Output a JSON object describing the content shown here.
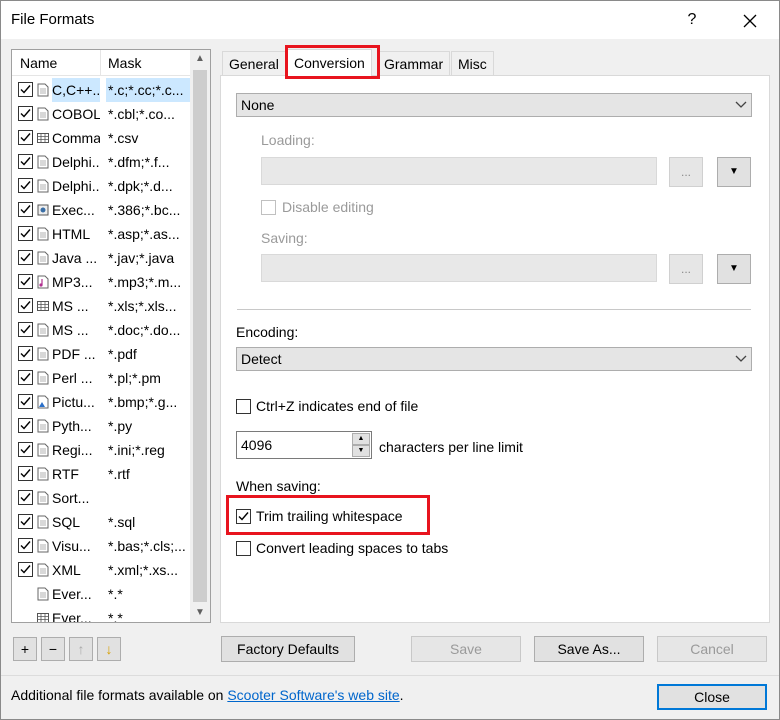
{
  "window": {
    "title": "File Formats",
    "help": "?"
  },
  "list": {
    "columns": [
      "Name",
      "Mask"
    ],
    "rows": [
      {
        "name": "C,C++...",
        "mask": "*.c;*.cc;*.c...",
        "checked": true,
        "icon": "doc-icon",
        "selected": true
      },
      {
        "name": "COBOL",
        "mask": "*.cbl;*.co...",
        "checked": true,
        "icon": "doc-icon"
      },
      {
        "name": "Comma...",
        "mask": "*.csv",
        "checked": true,
        "icon": "table-icon"
      },
      {
        "name": "Delphi...",
        "mask": "*.dfm;*.f...",
        "checked": true,
        "icon": "doc-icon"
      },
      {
        "name": "Delphi...",
        "mask": "*.dpk;*.d...",
        "checked": true,
        "icon": "doc-icon"
      },
      {
        "name": "Exec...",
        "mask": "*.386;*.bc...",
        "checked": true,
        "icon": "gear-icon"
      },
      {
        "name": "HTML",
        "mask": "*.asp;*.as...",
        "checked": true,
        "icon": "doc-icon"
      },
      {
        "name": "Java ...",
        "mask": "*.jav;*.java",
        "checked": true,
        "icon": "doc-icon"
      },
      {
        "name": "MP3...",
        "mask": "*.mp3;*.m...",
        "checked": true,
        "icon": "music-icon"
      },
      {
        "name": "MS ...",
        "mask": "*.xls;*.xls...",
        "checked": true,
        "icon": "table-icon"
      },
      {
        "name": "MS ...",
        "mask": "*.doc;*.do...",
        "checked": true,
        "icon": "doc-icon"
      },
      {
        "name": "PDF ...",
        "mask": "*.pdf",
        "checked": true,
        "icon": "doc-icon"
      },
      {
        "name": "Perl ...",
        "mask": "*.pl;*.pm",
        "checked": true,
        "icon": "doc-icon"
      },
      {
        "name": "Pictu...",
        "mask": "*.bmp;*.g...",
        "checked": true,
        "icon": "picture-icon"
      },
      {
        "name": "Pyth...",
        "mask": "*.py",
        "checked": true,
        "icon": "doc-icon"
      },
      {
        "name": "Regi...",
        "mask": "*.ini;*.reg",
        "checked": true,
        "icon": "doc-icon"
      },
      {
        "name": "RTF",
        "mask": "*.rtf",
        "checked": true,
        "icon": "doc-icon"
      },
      {
        "name": "Sort...",
        "mask": "",
        "checked": true,
        "icon": "doc-icon"
      },
      {
        "name": "SQL",
        "mask": "*.sql",
        "checked": true,
        "icon": "doc-icon"
      },
      {
        "name": "Visu...",
        "mask": "*.bas;*.cls;...",
        "checked": true,
        "icon": "doc-icon"
      },
      {
        "name": "XML",
        "mask": "*.xml;*.xs...",
        "checked": true,
        "icon": "doc-icon"
      },
      {
        "name": "Ever...",
        "mask": "*.*",
        "checked": false,
        "icon": "doc-icon"
      },
      {
        "name": "Ever...",
        "mask": "*.*",
        "checked": false,
        "icon": "table-icon"
      }
    ]
  },
  "list_buttons": {
    "add": "+",
    "remove": "−",
    "up": "↑",
    "down": "↓"
  },
  "tabs": [
    {
      "label": "General"
    },
    {
      "label": "Conversion",
      "active": true
    },
    {
      "label": "Grammar"
    },
    {
      "label": "Misc"
    }
  ],
  "conversion": {
    "type_value": "None",
    "loading_label": "Loading:",
    "disable_editing_label": "Disable editing",
    "saving_label": "Saving:",
    "browse_label": "...",
    "encoding_label": "Encoding:",
    "encoding_value": "Detect",
    "ctrlz_label": "Ctrl+Z indicates end of file",
    "line_limit_value": "4096",
    "line_limit_label": "characters per line limit",
    "when_saving_label": "When saving:",
    "trim_label": "Trim trailing whitespace",
    "trim_checked": true,
    "convert_label": "Convert leading spaces to tabs",
    "convert_checked": false
  },
  "buttons": {
    "factory_defaults": "Factory Defaults",
    "save": "Save",
    "save_as": "Save As...",
    "cancel": "Cancel",
    "close": "Close"
  },
  "status": {
    "text": "Additional file formats available on ",
    "link": "Scooter Software's web site",
    "suffix": "."
  },
  "colors": {
    "highlight": "#e8141e",
    "selection": "#cce8ff",
    "link": "#0066cc",
    "focus": "#0078d7"
  }
}
